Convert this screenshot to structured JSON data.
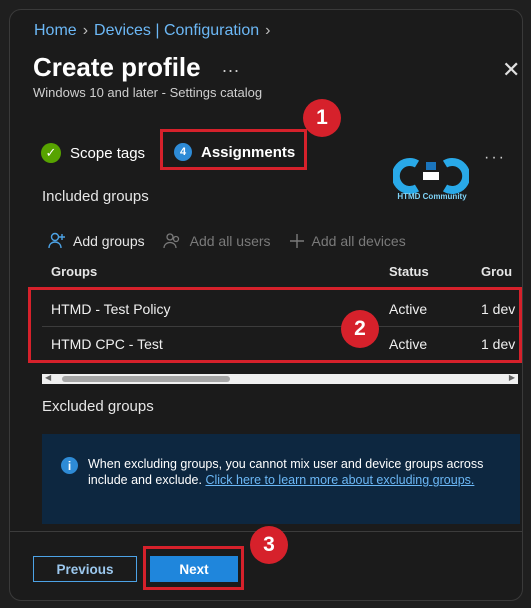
{
  "breadcrumb": [
    "Home",
    "Devices | Configuration"
  ],
  "header": {
    "title": "Create profile",
    "more": "...",
    "subtitle": "Windows 10 and later - Settings catalog",
    "close": "✕"
  },
  "steps": {
    "scope_tags": "Scope tags",
    "assignments_number": "4",
    "assignments": "Assignments"
  },
  "logo_caption": "HTMD Community",
  "annotations": [
    "1",
    "2",
    "3"
  ],
  "included_groups": {
    "heading": "Included groups",
    "toolbar": {
      "add_groups": "Add groups",
      "add_all_users": "Add all users",
      "add_all_devices": "Add all devices"
    },
    "columns": [
      "Groups",
      "Status",
      "Grou"
    ],
    "rows": [
      {
        "group": "HTMD - Test Policy",
        "status": "Active",
        "group_type": "1 dev"
      },
      {
        "group": "HTMD CPC - Test",
        "status": "Active",
        "group_type": "1 dev"
      }
    ]
  },
  "excluded_groups": {
    "heading": "Excluded groups",
    "info_text": "When excluding groups, you cannot mix user and device groups across include and exclude.",
    "info_link": "Click here to learn more about excluding groups."
  },
  "footer": {
    "previous": "Previous",
    "next": "Next"
  },
  "colors": {
    "accent": "#1f86dc",
    "link": "#6cb8f6",
    "annotation": "#d6212b",
    "success": "#57a300"
  }
}
